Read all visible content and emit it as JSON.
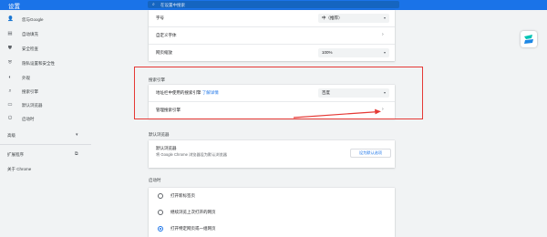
{
  "app": {
    "title": "设置"
  },
  "search": {
    "placeholder": "在设置中搜索",
    "icon": "search-icon"
  },
  "sidebar": {
    "items": [
      {
        "label": "您与Google",
        "icon": "person-icon",
        "glyph": "👤"
      },
      {
        "label": "自动填充",
        "icon": "clipboard-icon",
        "glyph": "▤"
      },
      {
        "label": "安全检查",
        "icon": "shield-icon",
        "glyph": "⛊"
      },
      {
        "label": "隐私设置和安全性",
        "icon": "shield-lock-icon",
        "glyph": "⛨"
      },
      {
        "label": "外观",
        "icon": "palette-icon",
        "glyph": "◐"
      },
      {
        "label": "搜索引擎",
        "icon": "search-icon",
        "glyph": "⌕"
      },
      {
        "label": "默认浏览器",
        "icon": "browser-icon",
        "glyph": "▭"
      },
      {
        "label": "启动时",
        "icon": "power-icon",
        "glyph": "⏻"
      }
    ],
    "advanced": "高级",
    "extensions": "扩展程序",
    "about": "关于 Chrome"
  },
  "appearance_card": {
    "font_size_label": "字号",
    "font_size_value": "中（推荐）",
    "custom_fonts_label": "自定义字体",
    "zoom_label": "网页缩放",
    "zoom_value": "100%"
  },
  "search_engine": {
    "heading": "搜索引擎",
    "address_bar_label": "地址栏中使用的搜索引擎",
    "learn_more": "了解详情",
    "engine_value": "百度",
    "manage_label": "管理搜索引擎"
  },
  "default_browser": {
    "heading": "默认浏览器",
    "title": "默认浏览器",
    "description": "将 Google Chrome 浏览器设为默认浏览器",
    "button": "设为默认选项"
  },
  "startup": {
    "heading": "启动时",
    "options": [
      {
        "label": "打开新标签页",
        "selected": false
      },
      {
        "label": "继续浏览上次打开的网页",
        "selected": false
      },
      {
        "label": "打开特定网页或一组网页",
        "selected": true
      }
    ]
  },
  "colors": {
    "accent": "#1a73e8",
    "highlight": "#e53935"
  }
}
